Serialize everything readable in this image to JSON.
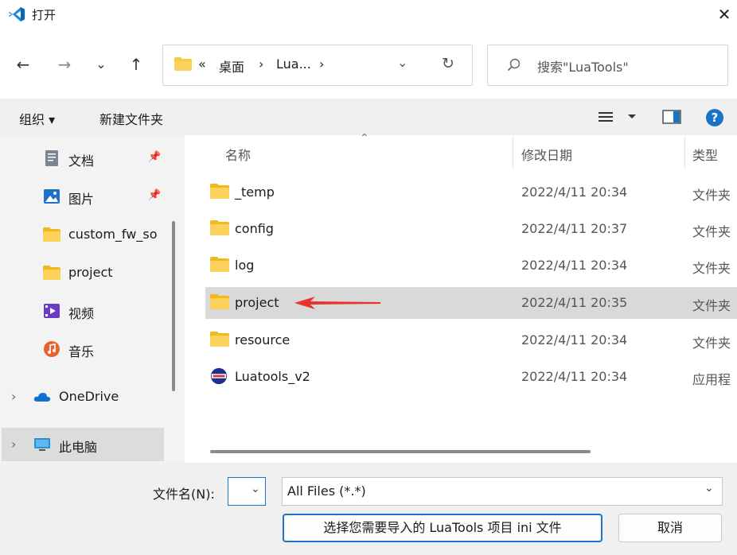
{
  "window": {
    "title": "打开",
    "close": "✕"
  },
  "nav": {
    "back": "←",
    "forward": "→",
    "recent": "⌄",
    "up": "↑"
  },
  "address": {
    "overflow": "«",
    "crumbs": [
      "桌面",
      "Lua..."
    ],
    "sep": "›",
    "dropdown": "⌄",
    "refresh": "↻"
  },
  "search": {
    "placeholder": "搜索\"LuaTools\""
  },
  "commands": {
    "organize": "组织 ▾",
    "new_folder": "新建文件夹"
  },
  "sidebar": {
    "items": [
      {
        "label": "文档",
        "icon": "document-icon"
      },
      {
        "label": "图片",
        "icon": "picture-icon"
      },
      {
        "label": "custom_fw_so",
        "icon": "folder-icon"
      },
      {
        "label": "project",
        "icon": "folder-icon"
      },
      {
        "label": "视频",
        "icon": "video-icon"
      },
      {
        "label": "音乐",
        "icon": "music-icon"
      },
      {
        "label": "OneDrive",
        "icon": "cloud-icon"
      },
      {
        "label": "此电脑",
        "icon": "computer-icon"
      }
    ],
    "expand": "›",
    "pin": "📌"
  },
  "columns": {
    "name": "名称",
    "date": "修改日期",
    "type": "类型",
    "sort": "⌃"
  },
  "files": [
    {
      "name": "_temp",
      "date": "2022/4/11 20:34",
      "type": "文件夹"
    },
    {
      "name": "config",
      "date": "2022/4/11 20:37",
      "type": "文件夹"
    },
    {
      "name": "log",
      "date": "2022/4/11 20:34",
      "type": "文件夹"
    },
    {
      "name": "project",
      "date": "2022/4/11 20:35",
      "type": "文件夹"
    },
    {
      "name": "resource",
      "date": "2022/4/11 20:34",
      "type": "文件夹"
    },
    {
      "name": "Luatools_v2",
      "date": "2022/4/11 20:34",
      "type": "应用程"
    }
  ],
  "bottom": {
    "filename_label": "文件名(N):",
    "filetype": "All Files (*.*)",
    "open_button": "选择您需要导入的 LuaTools 项目 ini 文件",
    "cancel_button": "取消"
  },
  "colors": {
    "folder": "#f7c948",
    "accent": "#1a73c7",
    "arrow": "#e8332a"
  }
}
